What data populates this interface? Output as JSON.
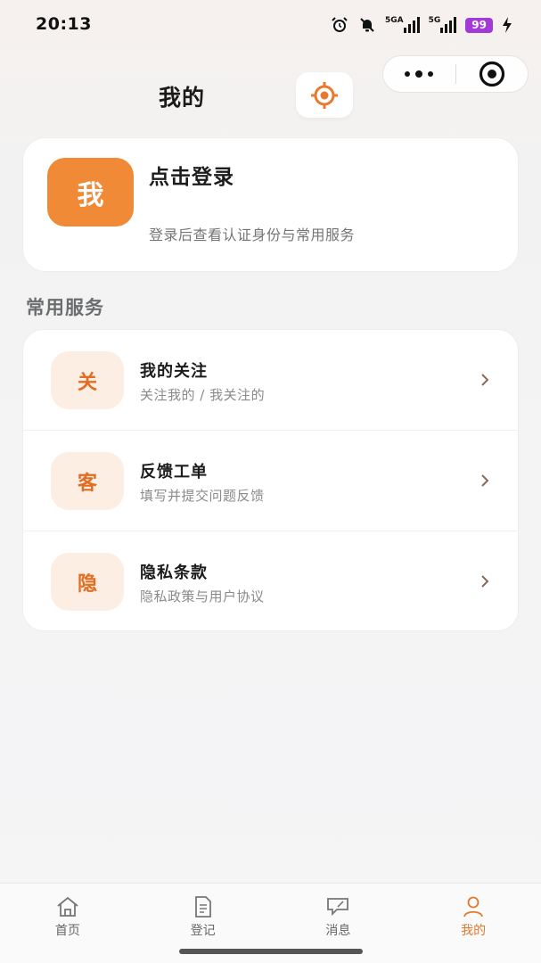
{
  "status_bar": {
    "time": "20:13",
    "net1": "5GA",
    "net2": "5G",
    "battery": "99",
    "icons": [
      "alarm-icon",
      "mute-icon",
      "signal-icon",
      "signal-icon",
      "battery-icon",
      "charging-icon"
    ]
  },
  "header": {
    "title": "我的",
    "locate_icon": "locate-icon",
    "capsule_icons": [
      "more-icon",
      "target-icon"
    ]
  },
  "profile": {
    "avatar": "我",
    "title": "点击登录",
    "subtitle": "登录后查看认证身份与常用服务"
  },
  "services": {
    "section_title": "常用服务",
    "items": [
      {
        "badge": "关",
        "title": "我的关注",
        "subtitle": "关注我的 / 我关注的"
      },
      {
        "badge": "客",
        "title": "反馈工单",
        "subtitle": "填写并提交问题反馈"
      },
      {
        "badge": "隐",
        "title": "隐私条款",
        "subtitle": "隐私政策与用户协议"
      }
    ]
  },
  "tabbar": {
    "active_index": 3,
    "items": [
      {
        "label": "首页",
        "icon": "home-icon"
      },
      {
        "label": "登记",
        "icon": "document-icon"
      },
      {
        "label": "消息",
        "icon": "message-icon"
      },
      {
        "label": "我的",
        "icon": "user-icon"
      }
    ]
  },
  "colors": {
    "accent": "#f08a36",
    "accent_text": "#e06d24",
    "badge_bg": "#fdeee3",
    "battery": "#a33ad8"
  }
}
